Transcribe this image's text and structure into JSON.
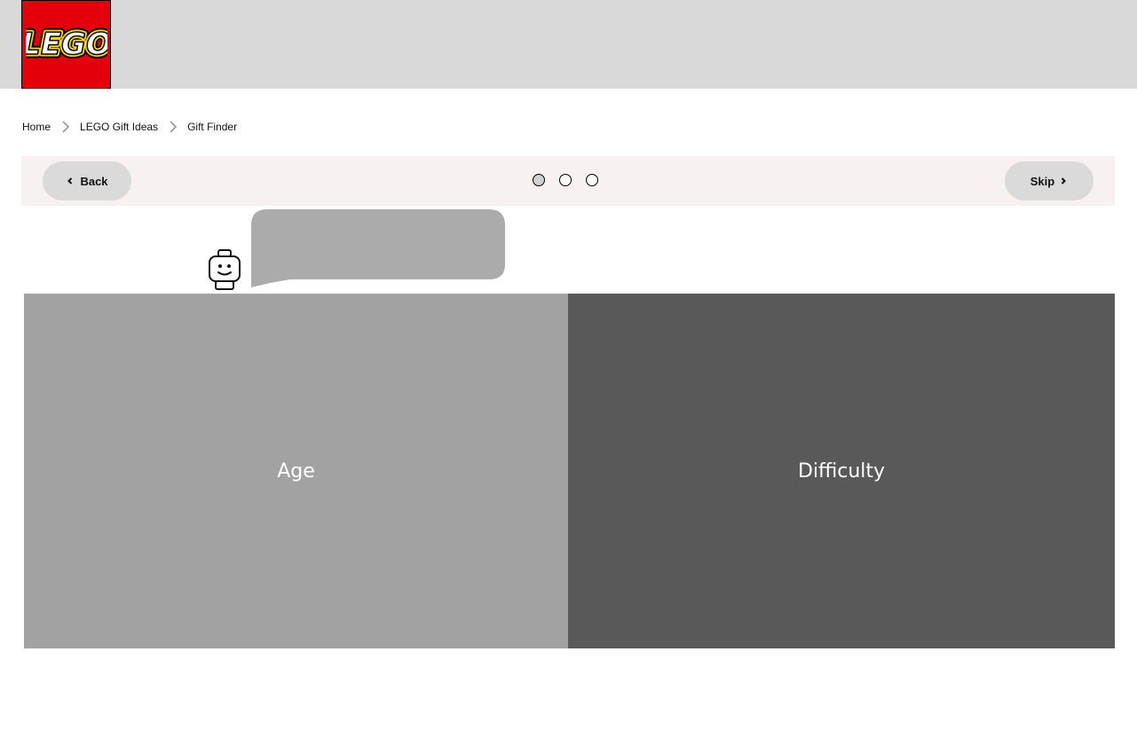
{
  "header": {
    "logo_text": "LEGO",
    "logo_icon": "lego-logo",
    "colors": {
      "bar": "#d9d9d9",
      "logo_red": "#e3000b",
      "logo_yellow": "#ffd500"
    }
  },
  "breadcrumb": {
    "items": [
      "Home",
      "LEGO Gift Ideas",
      "Gift Finder"
    ],
    "separator_icon": "chevron-right-icon"
  },
  "stepper": {
    "back_label": "Back",
    "skip_label": "Skip",
    "back_icon": "chevron-left-icon",
    "skip_icon": "chevron-right-icon",
    "steps_total": 3,
    "current_step": 1
  },
  "mascot": {
    "icon": "minifigure-head-icon",
    "bubble_color": "#ababab"
  },
  "options": [
    {
      "label": "Age",
      "color": "#a2a2a2"
    },
    {
      "label": "Difficulty",
      "color": "#595959"
    }
  ]
}
